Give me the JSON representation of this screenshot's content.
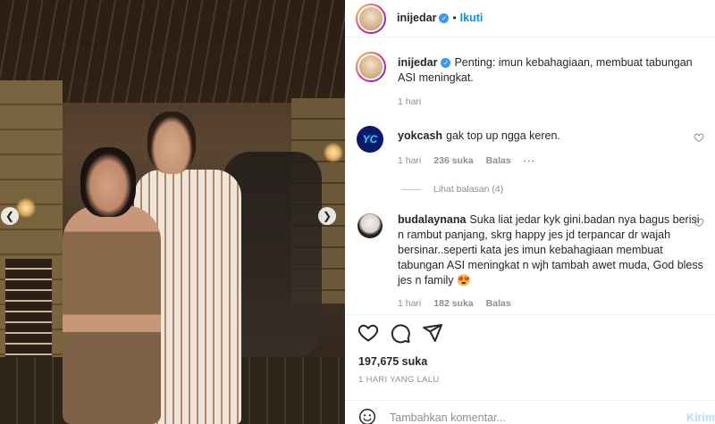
{
  "post_photo": {
    "nav_left_icon": "chevron-left-icon",
    "nav_right_icon": "chevron-right-icon"
  },
  "header": {
    "username": "inijedar",
    "separator": "•",
    "follow_label": "Ikuti",
    "more_icon": "more-horizontal-icon",
    "more_label": "⋯"
  },
  "caption": {
    "username": "inijedar",
    "text": "Penting: imun kebahagiaan, membuat tabungan ASI meningkat.",
    "time": "1 hari"
  },
  "comments": [
    {
      "username": "yokcash",
      "avatar_text": "YC",
      "text": "gak top up ngga keren.",
      "time": "1 hari",
      "likes": "236 suka",
      "reply_label": "Balas",
      "more_label": "···",
      "view_replies": "Lihat balasan (4)"
    },
    {
      "username": "budalaynana",
      "text": "Suka liat jedar kyk gini.badan nya bagus berisi n rambut panjang, skrg happy jes jd terpancar dr wajah bersinar..seperti kata jes imun kebahagiaan membuat tabungan ASI meningkat n wjh tambah awet muda, God bless jes n family 😍",
      "time": "1 hari",
      "likes": "182 suka",
      "reply_label": "Balas"
    }
  ],
  "actions": {
    "like_icon": "heart-icon",
    "comment_icon": "comment-icon",
    "share_icon": "send-icon"
  },
  "likes_count": "197,675 suka",
  "post_date": "1 HARI YANG LALU",
  "add_comment": {
    "emoji_icon": "smiley-icon",
    "placeholder": "Tambahkan komentar...",
    "post_label": "Kirim"
  },
  "colors": {
    "accent": "#0095f6",
    "verified": "#3897f0",
    "muted": "#8e8e8e",
    "text": "#262626"
  }
}
